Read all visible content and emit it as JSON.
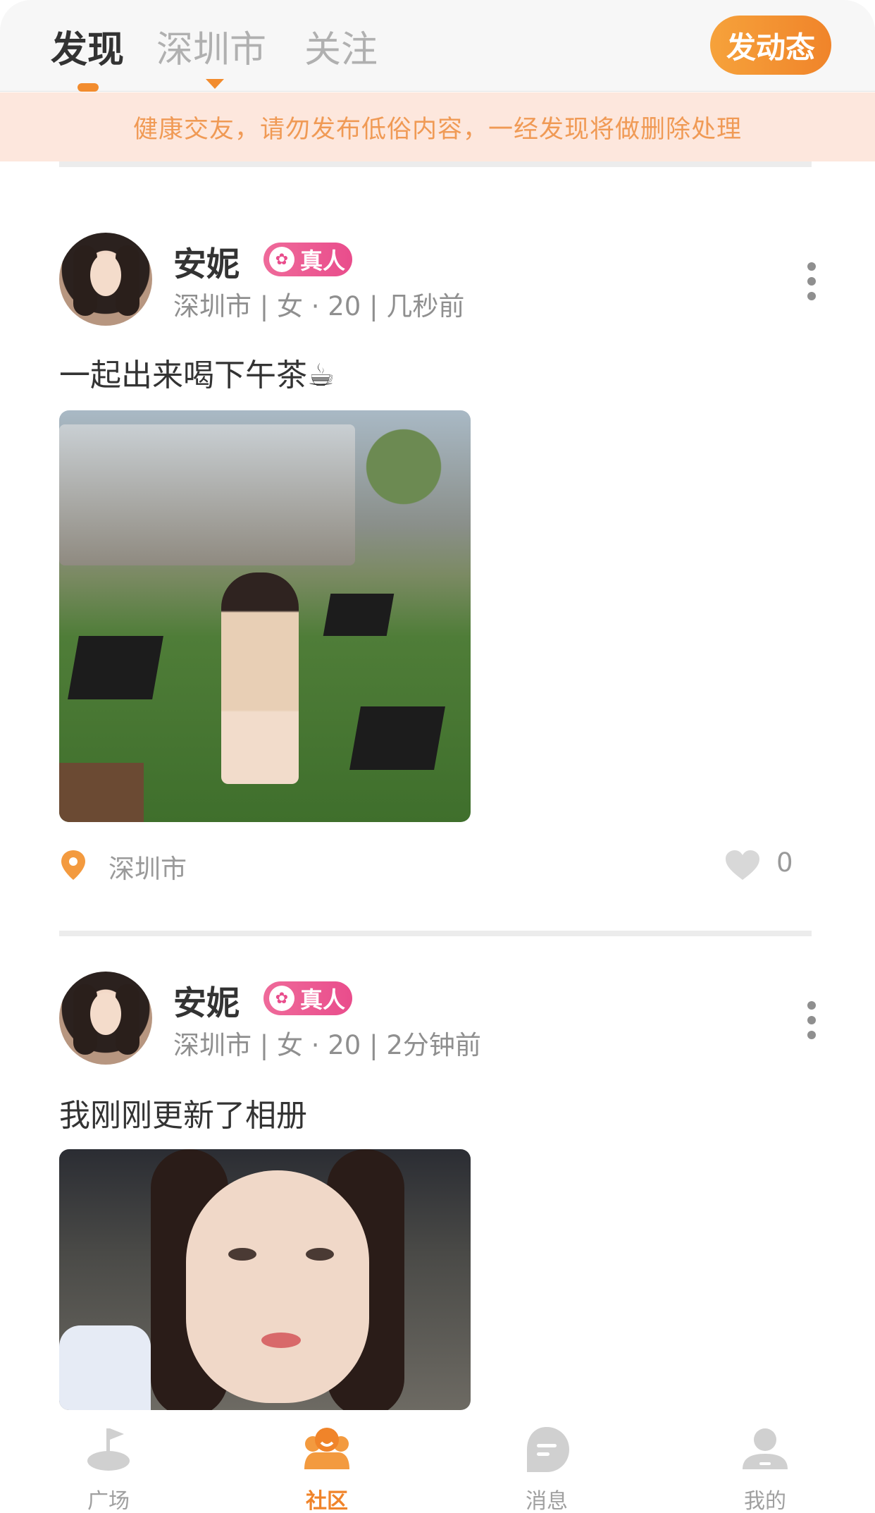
{
  "header": {
    "tabs": [
      {
        "label": "发现",
        "active": true
      },
      {
        "label": "深圳市",
        "active": false
      },
      {
        "label": "关注",
        "active": false
      }
    ],
    "post_button": "发动态",
    "accent_color": "#f0842a"
  },
  "notice": "健康交友，请勿发布低俗内容，一经发现将做删除处理",
  "posts": [
    {
      "name": "安妮",
      "badge": "真人",
      "meta": "深圳市 | 女 · 20 | 几秒前",
      "caption": "一起出来喝下午茶☕",
      "location": "深圳市",
      "likes": "0"
    },
    {
      "name": "安妮",
      "badge": "真人",
      "meta": "深圳市 | 女 · 20 | 2分钟前",
      "caption": "我刚刚更新了相册"
    }
  ],
  "bottom_nav": [
    {
      "label": "广场",
      "icon": "plaza-icon",
      "active": false
    },
    {
      "label": "社区",
      "icon": "community-icon",
      "active": true
    },
    {
      "label": "消息",
      "icon": "message-icon",
      "active": false
    },
    {
      "label": "我的",
      "icon": "profile-icon",
      "active": false
    }
  ]
}
